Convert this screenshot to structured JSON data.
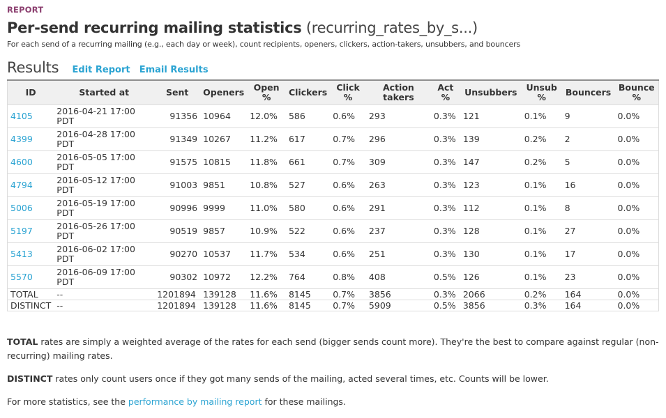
{
  "header": {
    "kicker": "REPORT",
    "title_bold": "Per-send recurring mailing statistics",
    "title_light": "(recurring_rates_by_s...)",
    "subtitle": "For each send of a recurring mailing (e.g., each day or week), count recipients, openers, clickers, action-takers, unsubbers, and bouncers"
  },
  "results": {
    "heading": "Results",
    "edit_report": "Edit Report",
    "email_results": "Email Results"
  },
  "colors": {
    "accent_link": "#2aa3d2",
    "kicker": "#8b3f6f"
  },
  "table": {
    "columns": [
      "ID",
      "Started at",
      "Sent",
      "Openers",
      "Open %",
      "Clickers",
      "Click %",
      "Action takers",
      "Act %",
      "Unsubbers",
      "Unsub %",
      "Bouncers",
      "Bounce %"
    ],
    "columns_line1": [
      "ID",
      "Started at",
      "Sent",
      "Openers",
      "Open",
      "Clickers",
      "Click",
      "Action",
      "Act",
      "Unsubbers",
      "Unsub",
      "Bouncers",
      "Bounce"
    ],
    "columns_line2": [
      "",
      "",
      "",
      "",
      "%",
      "",
      "%",
      "takers",
      "%",
      "",
      "%",
      "",
      "%"
    ],
    "rows": [
      [
        "4105",
        "2016-04-21 17:00 PDT",
        "91356",
        "10964",
        "12.0%",
        "586",
        "0.6%",
        "293",
        "0.3%",
        "121",
        "0.1%",
        "9",
        "0.0%"
      ],
      [
        "4399",
        "2016-04-28 17:00 PDT",
        "91349",
        "10267",
        "11.2%",
        "617",
        "0.7%",
        "296",
        "0.3%",
        "139",
        "0.2%",
        "2",
        "0.0%"
      ],
      [
        "4600",
        "2016-05-05 17:00 PDT",
        "91575",
        "10815",
        "11.8%",
        "661",
        "0.7%",
        "309",
        "0.3%",
        "147",
        "0.2%",
        "5",
        "0.0%"
      ],
      [
        "4794",
        "2016-05-12 17:00 PDT",
        "91003",
        "9851",
        "10.8%",
        "527",
        "0.6%",
        "263",
        "0.3%",
        "123",
        "0.1%",
        "16",
        "0.0%"
      ],
      [
        "5006",
        "2016-05-19 17:00 PDT",
        "90996",
        "9999",
        "11.0%",
        "580",
        "0.6%",
        "291",
        "0.3%",
        "112",
        "0.1%",
        "8",
        "0.0%"
      ],
      [
        "5197",
        "2016-05-26 17:00 PDT",
        "90519",
        "9857",
        "10.9%",
        "522",
        "0.6%",
        "237",
        "0.3%",
        "128",
        "0.1%",
        "27",
        "0.0%"
      ],
      [
        "5413",
        "2016-06-02 17:00 PDT",
        "90270",
        "10537",
        "11.7%",
        "534",
        "0.6%",
        "251",
        "0.3%",
        "130",
        "0.1%",
        "17",
        "0.0%"
      ],
      [
        "5570",
        "2016-06-09 17:00 PDT",
        "90302",
        "10972",
        "12.2%",
        "764",
        "0.8%",
        "408",
        "0.5%",
        "126",
        "0.1%",
        "23",
        "0.0%"
      ]
    ],
    "summary_rows": [
      [
        "TOTAL",
        "--",
        "1201894",
        "139128",
        "11.6%",
        "8145",
        "0.7%",
        "3856",
        "0.3%",
        "2066",
        "0.2%",
        "164",
        "0.0%"
      ],
      [
        "DISTINCT",
        "--",
        "1201894",
        "139128",
        "11.6%",
        "8145",
        "0.7%",
        "5909",
        "0.5%",
        "3856",
        "0.3%",
        "164",
        "0.0%"
      ]
    ]
  },
  "notes": {
    "total_label": "TOTAL",
    "total_text": " rates are simply a weighted average of the rates for each send (bigger sends count more). They're the best to compare against regular (non-recurring) mailing rates.",
    "distinct_label": "DISTINCT",
    "distinct_text": " rates only count users once if they got many sends of the mailing, acted several times, etc. Counts will be lower.",
    "more_prefix": "For more statistics, see the ",
    "more_link": "performance by mailing report",
    "more_suffix": " for these mailings."
  }
}
